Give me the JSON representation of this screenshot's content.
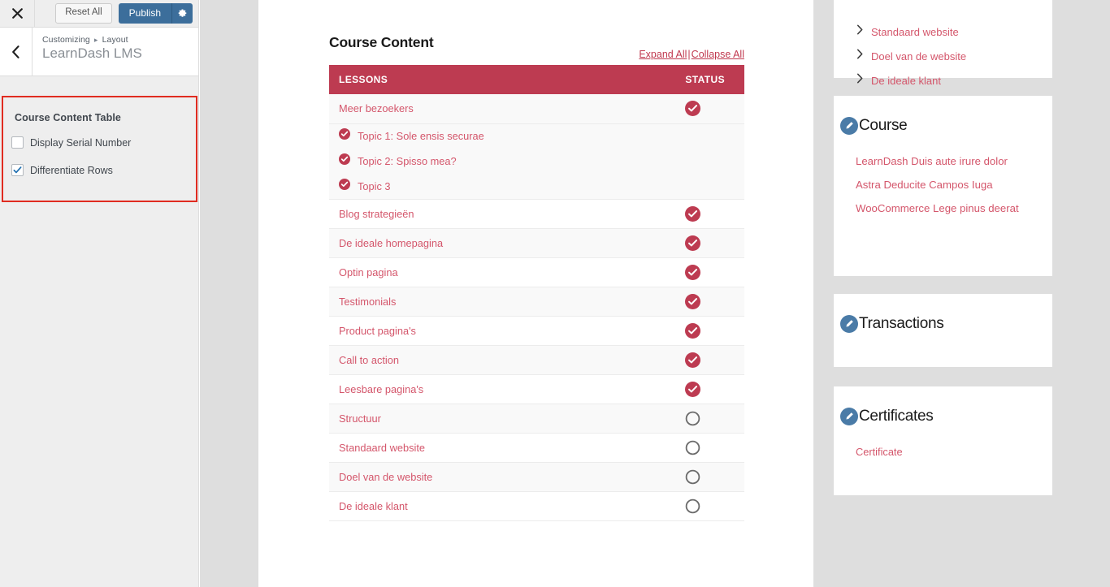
{
  "customizer": {
    "close_icon": "close-x-icon",
    "reset_label": "Reset All",
    "publish_label": "Publish",
    "gear_icon": "gear-icon",
    "back_icon": "chevron-left-icon",
    "breadcrumb_parent": "Customizing",
    "breadcrumb_sep": "▸",
    "breadcrumb_child": "Layout",
    "panel_title": "LearnDash LMS",
    "section": {
      "title": "Course Content Table",
      "highlight_color": "#e02b20",
      "options": [
        {
          "label": "Display Serial Number",
          "checked": false
        },
        {
          "label": "Differentiate Rows",
          "checked": true
        }
      ]
    }
  },
  "preview": {
    "course_content": {
      "heading": "Course Content",
      "expand_all": "Expand All",
      "separator": "|",
      "collapse_all": "Collapse All",
      "header_bg": "#bd3b51",
      "columns": [
        "LESSONS",
        "STATUS"
      ],
      "rows": [
        {
          "label": "Meer bezoekers",
          "status": "complete",
          "shade": "alt",
          "topics": [
            {
              "label": "Topic 1: Sole ensis securae",
              "status": "complete"
            },
            {
              "label": "Topic 2: Spisso mea?",
              "status": "complete"
            },
            {
              "label": "Topic 3",
              "status": "complete"
            }
          ]
        },
        {
          "label": "Blog strategieën",
          "status": "complete",
          "shade": "plain",
          "topics": []
        },
        {
          "label": "De ideale homepagina",
          "status": "complete",
          "shade": "alt",
          "topics": []
        },
        {
          "label": "Optin pagina",
          "status": "complete",
          "shade": "plain",
          "topics": []
        },
        {
          "label": "Testimonials",
          "status": "complete",
          "shade": "alt",
          "topics": []
        },
        {
          "label": "Product pagina's",
          "status": "complete",
          "shade": "plain",
          "topics": []
        },
        {
          "label": "Call to action",
          "status": "complete",
          "shade": "alt",
          "topics": []
        },
        {
          "label": "Leesbare pagina's",
          "status": "complete",
          "shade": "plain",
          "topics": []
        },
        {
          "label": "Structuur",
          "status": "incomplete",
          "shade": "alt",
          "topics": []
        },
        {
          "label": "Standaard website",
          "status": "incomplete",
          "shade": "plain",
          "topics": []
        },
        {
          "label": "Doel van de website",
          "status": "incomplete",
          "shade": "alt",
          "topics": []
        },
        {
          "label": "De ideale klant",
          "status": "incomplete",
          "shade": "plain",
          "topics": []
        }
      ]
    }
  },
  "sidebar_widgets": {
    "lesson_nav": {
      "items": [
        {
          "label": "Standaard website"
        },
        {
          "label": "Doel van de website"
        },
        {
          "label": "De ideale klant"
        }
      ]
    },
    "course": {
      "title": "Course",
      "edit_icon": "pencil-edit-icon",
      "links": [
        "LearnDash Duis aute irure dolor",
        "Astra Deducite Campos Iuga",
        "WooCommerce Lege pinus deerat"
      ]
    },
    "transactions": {
      "title": "Transactions",
      "edit_icon": "pencil-edit-icon",
      "links": []
    },
    "certificates": {
      "title": "Certificates",
      "edit_icon": "pencil-edit-icon",
      "links": [
        "Certificate"
      ]
    }
  },
  "colors": {
    "accent_red": "#bd3b51",
    "link_red": "#d4566b",
    "publish_blue": "#3c6e9b",
    "badge_blue": "#4a7ba7",
    "ring_gray": "#6b6b6b"
  }
}
